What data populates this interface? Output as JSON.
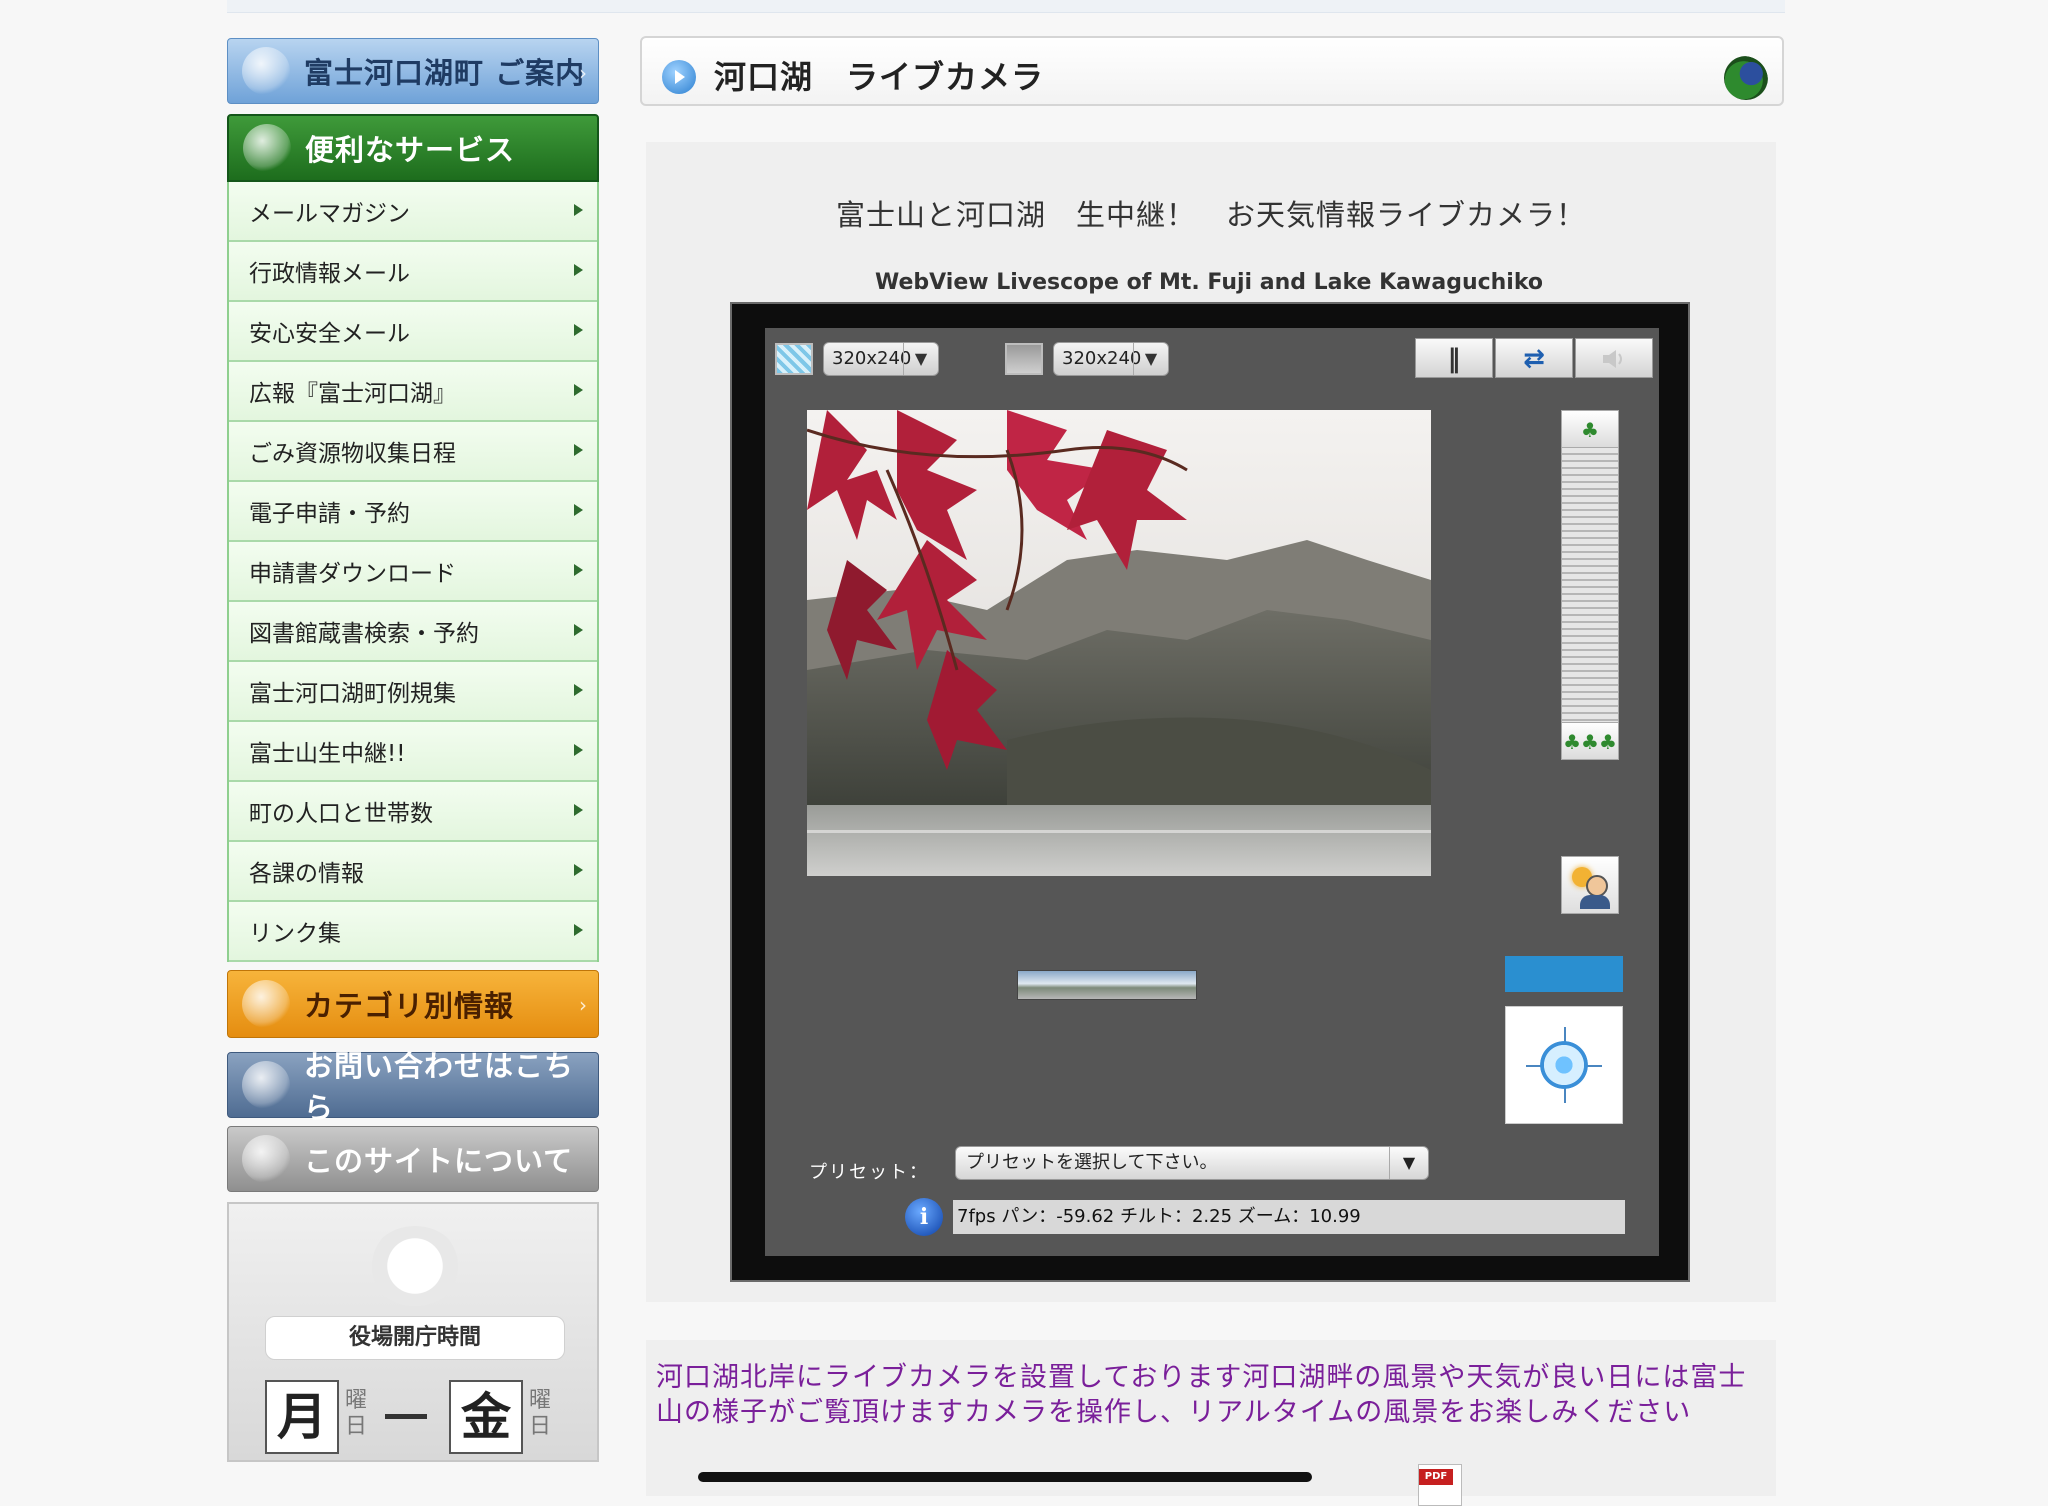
{
  "sidebar": {
    "guide_label": "富士河口湖町 ご案内",
    "service_label": "便利なサービス",
    "items": [
      {
        "label": "メールマガジン"
      },
      {
        "label": "行政情報メール"
      },
      {
        "label": "安心安全メール"
      },
      {
        "label": "広報『富士河口湖』"
      },
      {
        "label": "ごみ資源物収集日程"
      },
      {
        "label": "電子申請・予約"
      },
      {
        "label": "申請書ダウンロード"
      },
      {
        "label": "図書館蔵書検索・予約"
      },
      {
        "label": "富士河口湖町例規集"
      },
      {
        "label": "富士山生中継!!"
      },
      {
        "label": "町の人口と世帯数"
      },
      {
        "label": "各課の情報"
      },
      {
        "label": "リンク集"
      }
    ],
    "category_label": "カテゴリ別情報",
    "contact_label": "お問い合わせはこちら",
    "about_label": "このサイトについて",
    "hours": {
      "title": "役場開庁時間",
      "from_day": "月",
      "to_day": "金",
      "yobi": "曜日"
    }
  },
  "main": {
    "title": "河口湖　ライブカメラ",
    "headline": "富士山と河口湖　生中継！　お天気情報ライブカメラ！",
    "subhead": "WebView Livescope of Mt. Fuji and Lake Kawaguchiko",
    "viewer": {
      "size1": "320x240",
      "size2": "320x240",
      "pause_icon": "‖",
      "swap_icon": "⇄",
      "preset_label": "プリセット：",
      "preset_placeholder": "プリセットを選択して下さい。",
      "status": "7fps パン：-59.62 チルト：2.25 ズーム：10.99"
    },
    "description": "河口湖北岸にライブカメラを設置しております河口湖畔の風景や天気が良い日には富士山の様子がご覧頂けますカメラを操作し、リアルタイムの風景をお楽しみください",
    "pdf_label": "PDF"
  },
  "colors": {
    "service_green": "#2a7f2a",
    "category_orange": "#f0a020",
    "description_purple": "#7a1f9a",
    "cam_bg": "#565656"
  }
}
